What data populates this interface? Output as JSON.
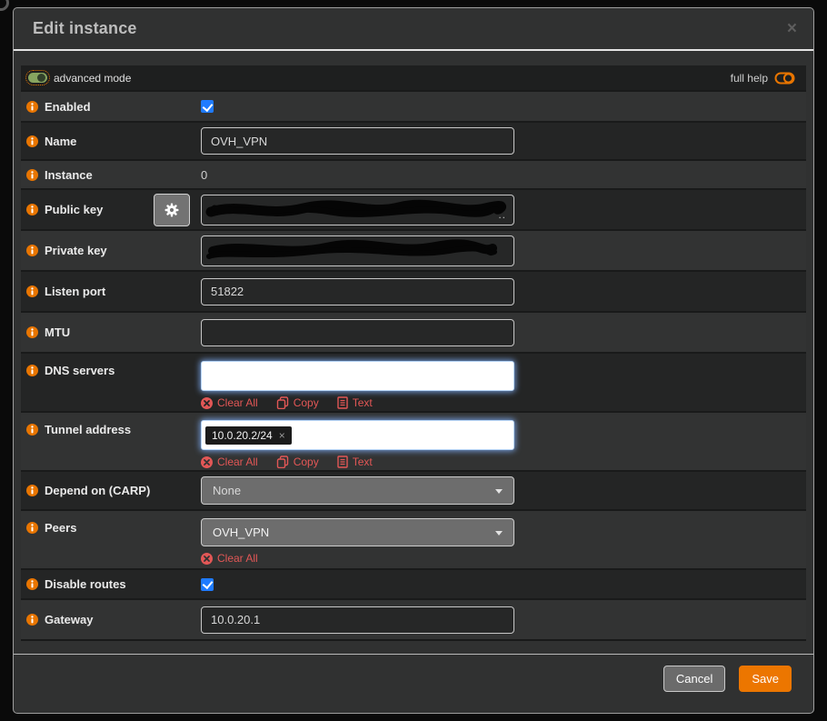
{
  "dialog": {
    "title": "Edit instance",
    "close_icon": "×"
  },
  "helpbar": {
    "advanced_mode_label": "advanced mode",
    "full_help_label": "full help"
  },
  "links": {
    "clear_all": "Clear All",
    "copy": "Copy",
    "text": "Text"
  },
  "icons": {
    "token_remove": "×"
  },
  "fields": {
    "enabled": {
      "label": "Enabled",
      "checked": true
    },
    "name": {
      "label": "Name",
      "value": "OVH_VPN"
    },
    "instance": {
      "label": "Instance",
      "value": "0"
    },
    "public_key": {
      "label": "Public key",
      "redacted": true,
      "suffix": ".."
    },
    "private_key": {
      "label": "Private key",
      "redacted": true
    },
    "listen_port": {
      "label": "Listen port",
      "value": "51822"
    },
    "mtu": {
      "label": "MTU",
      "value": ""
    },
    "dns_servers": {
      "label": "DNS servers",
      "tokens": []
    },
    "tunnel_address": {
      "label": "Tunnel address",
      "tokens": [
        "10.0.20.2/24"
      ]
    },
    "depend_on_carp": {
      "label": "Depend on (CARP)",
      "value": "None"
    },
    "peers": {
      "label": "Peers",
      "value": "OVH_VPN"
    },
    "disable_routes": {
      "label": "Disable routes",
      "checked": true
    },
    "gateway": {
      "label": "Gateway",
      "value": "10.0.20.1"
    }
  },
  "footer": {
    "cancel_label": "Cancel",
    "save_label": "Save"
  },
  "colors": {
    "accent_orange": "#e87500",
    "link_red": "#e25756",
    "checkbox_blue": "#1f7bff",
    "row_light": "#323333",
    "row_dark": "#242525",
    "modal_bg": "#303131",
    "token_bg": "#1b1b1b",
    "save_button": "#ec7600"
  }
}
